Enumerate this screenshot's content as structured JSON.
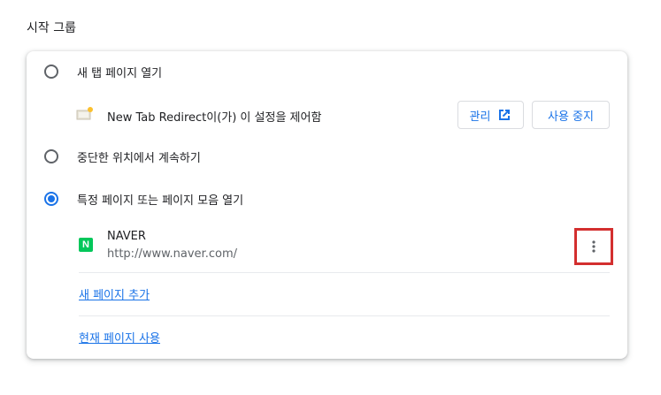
{
  "section": {
    "title": "시작 그룹"
  },
  "options": [
    {
      "label": "새 탭 페이지 열기",
      "checked": false
    },
    {
      "label": "중단한 위치에서 계속하기",
      "checked": false
    },
    {
      "label": "특정 페이지 또는 페이지 모음 열기",
      "checked": true
    }
  ],
  "extension": {
    "text": "New Tab Redirect이(가) 이 설정을 제어함",
    "manage_label": "관리",
    "disable_label": "사용 중지"
  },
  "pages": [
    {
      "name": "NAVER",
      "url": "http://www.naver.com/",
      "favicon_letter": "N"
    }
  ],
  "actions": {
    "add_page": "새 페이지 추가",
    "use_current": "현재 페이지 사용"
  },
  "colors": {
    "accent": "#1a73e8",
    "highlight_box": "#d32f2f",
    "naver_green": "#03c75a"
  }
}
